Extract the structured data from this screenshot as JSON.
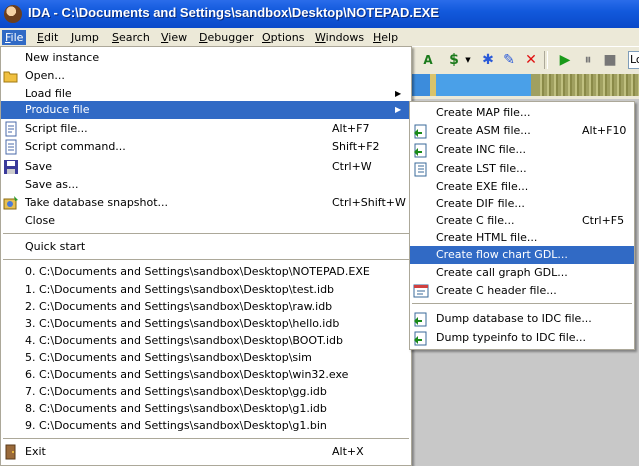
{
  "window": {
    "title": "IDA - C:\\Documents and Settings\\sandbox\\Desktop\\NOTEPAD.EXE"
  },
  "menubar": [
    {
      "label": "File",
      "accel": "F",
      "rest": "ile"
    },
    {
      "label": "Edit",
      "accel": "E",
      "rest": "dit"
    },
    {
      "label": "Jump",
      "accel": "J",
      "rest": "ump"
    },
    {
      "label": "Search",
      "accel": "S",
      "rest": "earch"
    },
    {
      "label": "View",
      "accel": "V",
      "rest": "iew"
    },
    {
      "label": "Debugger",
      "accel": "D",
      "rest": "ebugger"
    },
    {
      "label": "Options",
      "accel": "O",
      "rest": "ptions"
    },
    {
      "label": "Windows",
      "accel": "W",
      "rest": "indows"
    },
    {
      "label": "Help",
      "accel": "H",
      "rest": "elp"
    }
  ],
  "toolbar": {
    "combo_text": "Lo",
    "icons": [
      "code-icon",
      "data-icon",
      "star-icon",
      "rename-icon",
      "delete-icon",
      "run-icon",
      "pause-icon",
      "stop-icon"
    ]
  },
  "file_menu": {
    "items": [
      {
        "label": "New instance",
        "shortcut": ""
      },
      {
        "label": "Open...",
        "shortcut": ""
      },
      {
        "label": "Load file",
        "shortcut": ""
      },
      {
        "label": "Produce file",
        "shortcut": ""
      },
      {
        "label": "Script file...",
        "shortcut": "Alt+F7"
      },
      {
        "label": "Script command...",
        "shortcut": "Shift+F2"
      },
      {
        "label": "Save",
        "shortcut": "Ctrl+W"
      },
      {
        "label": "Save as...",
        "shortcut": ""
      },
      {
        "label": "Take database snapshot...",
        "shortcut": "Ctrl+Shift+W"
      },
      {
        "label": "Close",
        "shortcut": ""
      },
      {
        "label": "Quick start",
        "shortcut": ""
      },
      {
        "label": "0. C:\\Documents and Settings\\sandbox\\Desktop\\NOTEPAD.EXE"
      },
      {
        "label": "1. C:\\Documents and Settings\\sandbox\\Desktop\\test.idb"
      },
      {
        "label": "2. C:\\Documents and Settings\\sandbox\\Desktop\\raw.idb"
      },
      {
        "label": "3. C:\\Documents and Settings\\sandbox\\Desktop\\hello.idb"
      },
      {
        "label": "4. C:\\Documents and Settings\\sandbox\\Desktop\\BOOT.idb"
      },
      {
        "label": "5. C:\\Documents and Settings\\sandbox\\Desktop\\sim"
      },
      {
        "label": "6. C:\\Documents and Settings\\sandbox\\Desktop\\win32.exe"
      },
      {
        "label": "7. C:\\Documents and Settings\\sandbox\\Desktop\\gg.idb"
      },
      {
        "label": "8. C:\\Documents and Settings\\sandbox\\Desktop\\g1.idb"
      },
      {
        "label": "9. C:\\Documents and Settings\\sandbox\\Desktop\\g1.bin"
      },
      {
        "label": "Exit",
        "shortcut": "Alt+X"
      }
    ]
  },
  "produce_menu": {
    "items": [
      {
        "label": "Create MAP file...",
        "shortcut": ""
      },
      {
        "label": "Create ASM file...",
        "shortcut": "Alt+F10"
      },
      {
        "label": "Create INC file...",
        "shortcut": ""
      },
      {
        "label": "Create LST file...",
        "shortcut": ""
      },
      {
        "label": "Create EXE file...",
        "shortcut": ""
      },
      {
        "label": "Create DIF file...",
        "shortcut": ""
      },
      {
        "label": "Create C file...",
        "shortcut": "Ctrl+F5"
      },
      {
        "label": "Create HTML file...",
        "shortcut": ""
      },
      {
        "label": "Create flow chart GDL...",
        "shortcut": ""
      },
      {
        "label": "Create call graph GDL...",
        "shortcut": ""
      },
      {
        "label": "Create C header file...",
        "shortcut": ""
      },
      {
        "label": "Dump database to IDC file...",
        "shortcut": ""
      },
      {
        "label": "Dump typeinfo to IDC file...",
        "shortcut": ""
      }
    ]
  },
  "colors": {
    "highlight": "#316ac5",
    "titlebar": "#0a49c9",
    "nav_code": "#3c8cdc",
    "nav_data": "#a0a060"
  }
}
